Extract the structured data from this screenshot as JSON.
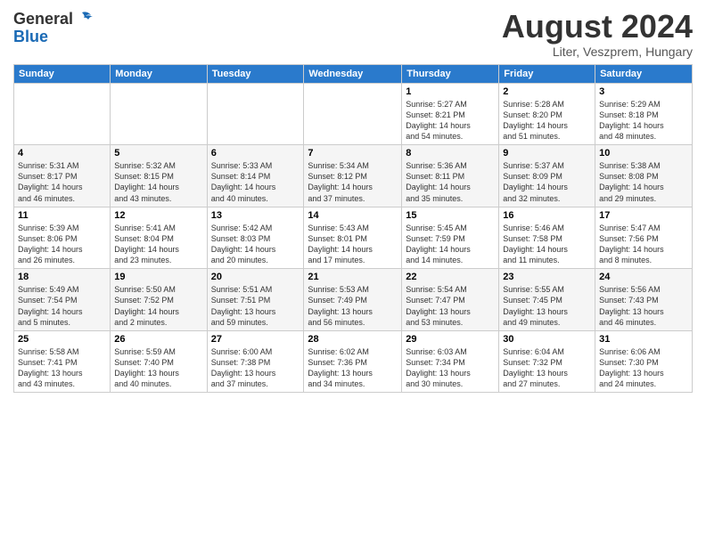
{
  "header": {
    "logo_general": "General",
    "logo_blue": "Blue",
    "month_title": "August 2024",
    "location": "Liter, Veszprem, Hungary"
  },
  "weekdays": [
    "Sunday",
    "Monday",
    "Tuesday",
    "Wednesday",
    "Thursday",
    "Friday",
    "Saturday"
  ],
  "weeks": [
    [
      {
        "day": "",
        "info": ""
      },
      {
        "day": "",
        "info": ""
      },
      {
        "day": "",
        "info": ""
      },
      {
        "day": "",
        "info": ""
      },
      {
        "day": "1",
        "info": "Sunrise: 5:27 AM\nSunset: 8:21 PM\nDaylight: 14 hours\nand 54 minutes."
      },
      {
        "day": "2",
        "info": "Sunrise: 5:28 AM\nSunset: 8:20 PM\nDaylight: 14 hours\nand 51 minutes."
      },
      {
        "day": "3",
        "info": "Sunrise: 5:29 AM\nSunset: 8:18 PM\nDaylight: 14 hours\nand 48 minutes."
      }
    ],
    [
      {
        "day": "4",
        "info": "Sunrise: 5:31 AM\nSunset: 8:17 PM\nDaylight: 14 hours\nand 46 minutes."
      },
      {
        "day": "5",
        "info": "Sunrise: 5:32 AM\nSunset: 8:15 PM\nDaylight: 14 hours\nand 43 minutes."
      },
      {
        "day": "6",
        "info": "Sunrise: 5:33 AM\nSunset: 8:14 PM\nDaylight: 14 hours\nand 40 minutes."
      },
      {
        "day": "7",
        "info": "Sunrise: 5:34 AM\nSunset: 8:12 PM\nDaylight: 14 hours\nand 37 minutes."
      },
      {
        "day": "8",
        "info": "Sunrise: 5:36 AM\nSunset: 8:11 PM\nDaylight: 14 hours\nand 35 minutes."
      },
      {
        "day": "9",
        "info": "Sunrise: 5:37 AM\nSunset: 8:09 PM\nDaylight: 14 hours\nand 32 minutes."
      },
      {
        "day": "10",
        "info": "Sunrise: 5:38 AM\nSunset: 8:08 PM\nDaylight: 14 hours\nand 29 minutes."
      }
    ],
    [
      {
        "day": "11",
        "info": "Sunrise: 5:39 AM\nSunset: 8:06 PM\nDaylight: 14 hours\nand 26 minutes."
      },
      {
        "day": "12",
        "info": "Sunrise: 5:41 AM\nSunset: 8:04 PM\nDaylight: 14 hours\nand 23 minutes."
      },
      {
        "day": "13",
        "info": "Sunrise: 5:42 AM\nSunset: 8:03 PM\nDaylight: 14 hours\nand 20 minutes."
      },
      {
        "day": "14",
        "info": "Sunrise: 5:43 AM\nSunset: 8:01 PM\nDaylight: 14 hours\nand 17 minutes."
      },
      {
        "day": "15",
        "info": "Sunrise: 5:45 AM\nSunset: 7:59 PM\nDaylight: 14 hours\nand 14 minutes."
      },
      {
        "day": "16",
        "info": "Sunrise: 5:46 AM\nSunset: 7:58 PM\nDaylight: 14 hours\nand 11 minutes."
      },
      {
        "day": "17",
        "info": "Sunrise: 5:47 AM\nSunset: 7:56 PM\nDaylight: 14 hours\nand 8 minutes."
      }
    ],
    [
      {
        "day": "18",
        "info": "Sunrise: 5:49 AM\nSunset: 7:54 PM\nDaylight: 14 hours\nand 5 minutes."
      },
      {
        "day": "19",
        "info": "Sunrise: 5:50 AM\nSunset: 7:52 PM\nDaylight: 14 hours\nand 2 minutes."
      },
      {
        "day": "20",
        "info": "Sunrise: 5:51 AM\nSunset: 7:51 PM\nDaylight: 13 hours\nand 59 minutes."
      },
      {
        "day": "21",
        "info": "Sunrise: 5:53 AM\nSunset: 7:49 PM\nDaylight: 13 hours\nand 56 minutes."
      },
      {
        "day": "22",
        "info": "Sunrise: 5:54 AM\nSunset: 7:47 PM\nDaylight: 13 hours\nand 53 minutes."
      },
      {
        "day": "23",
        "info": "Sunrise: 5:55 AM\nSunset: 7:45 PM\nDaylight: 13 hours\nand 49 minutes."
      },
      {
        "day": "24",
        "info": "Sunrise: 5:56 AM\nSunset: 7:43 PM\nDaylight: 13 hours\nand 46 minutes."
      }
    ],
    [
      {
        "day": "25",
        "info": "Sunrise: 5:58 AM\nSunset: 7:41 PM\nDaylight: 13 hours\nand 43 minutes."
      },
      {
        "day": "26",
        "info": "Sunrise: 5:59 AM\nSunset: 7:40 PM\nDaylight: 13 hours\nand 40 minutes."
      },
      {
        "day": "27",
        "info": "Sunrise: 6:00 AM\nSunset: 7:38 PM\nDaylight: 13 hours\nand 37 minutes."
      },
      {
        "day": "28",
        "info": "Sunrise: 6:02 AM\nSunset: 7:36 PM\nDaylight: 13 hours\nand 34 minutes."
      },
      {
        "day": "29",
        "info": "Sunrise: 6:03 AM\nSunset: 7:34 PM\nDaylight: 13 hours\nand 30 minutes."
      },
      {
        "day": "30",
        "info": "Sunrise: 6:04 AM\nSunset: 7:32 PM\nDaylight: 13 hours\nand 27 minutes."
      },
      {
        "day": "31",
        "info": "Sunrise: 6:06 AM\nSunset: 7:30 PM\nDaylight: 13 hours\nand 24 minutes."
      }
    ]
  ]
}
